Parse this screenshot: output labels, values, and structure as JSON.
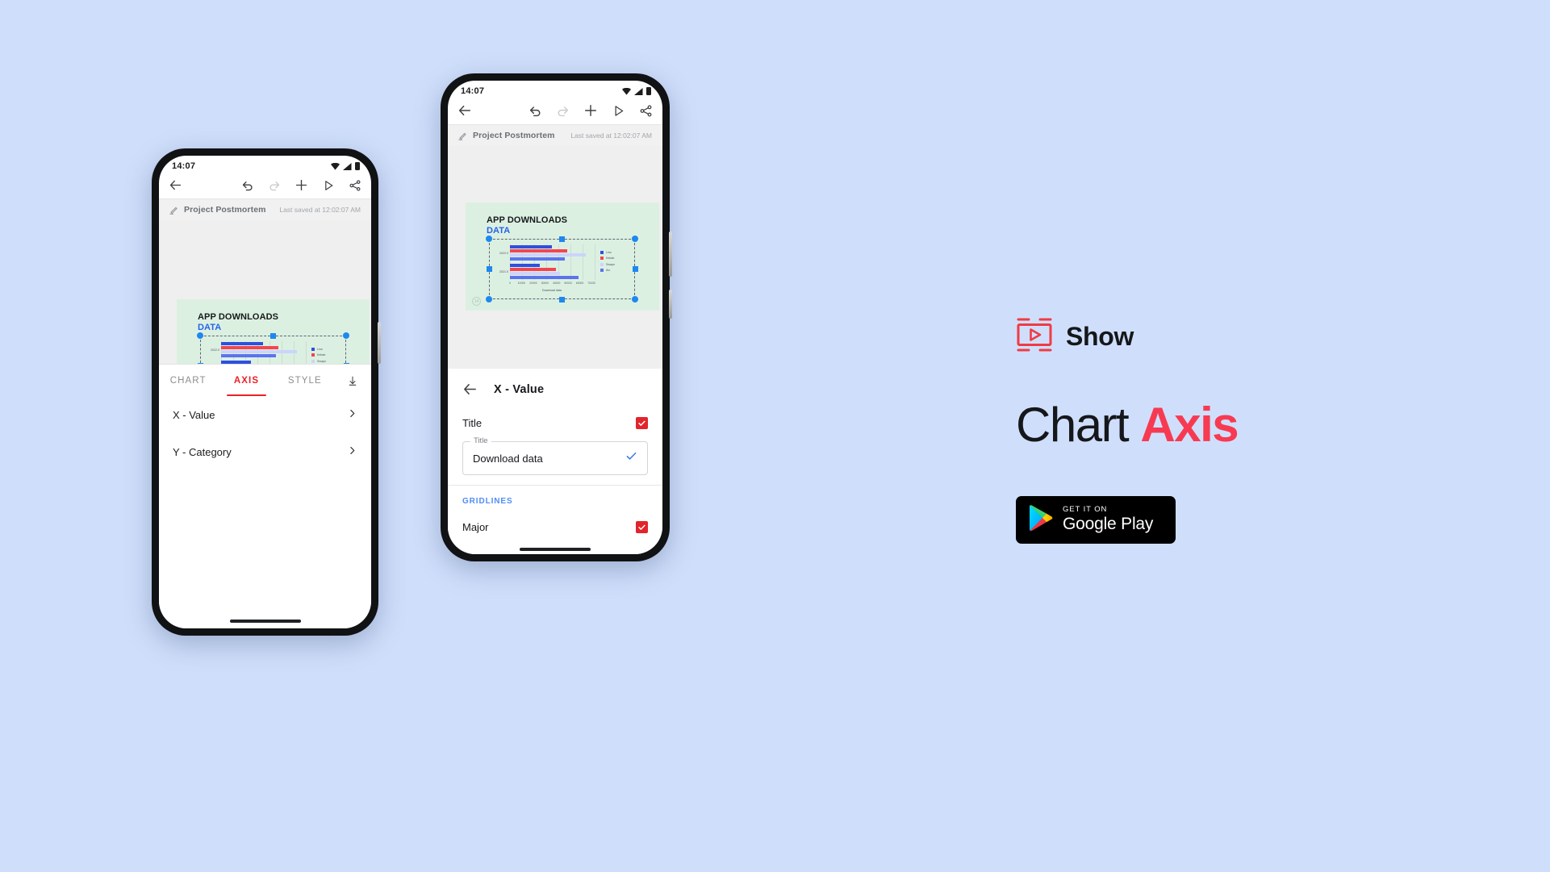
{
  "background_color": "#cfdffb",
  "accent_red": "#ea2027",
  "accent_blue": "#2563eb",
  "phone_editor": {
    "status": {
      "time": "14:07",
      "icons": [
        "wifi-icon",
        "signal-icon",
        "battery-icon"
      ]
    },
    "toolbar": {
      "back": "back-arrow-icon",
      "undo": "undo-icon",
      "redo": "redo-icon",
      "add": "plus-icon",
      "present": "play-icon",
      "share": "share-icon"
    },
    "document": {
      "icon": "edit-pencil-icon",
      "title": "Project Postmortem",
      "saved_status": "Last saved at 12:02:07 AM"
    },
    "tabs": [
      {
        "label": "CHART",
        "active": false
      },
      {
        "label": "AXIS",
        "active": true
      },
      {
        "label": "STYLE",
        "active": false
      }
    ],
    "collapse_icon": "collapse-down-icon",
    "rows": [
      {
        "label": "X - Value",
        "chevron": "chevron-right-icon"
      },
      {
        "label": "Y - Category",
        "chevron": "chevron-right-icon"
      }
    ]
  },
  "phone_detail": {
    "status": {
      "time": "14:07",
      "icons": [
        "wifi-icon",
        "signal-icon",
        "battery-icon"
      ]
    },
    "toolbar": {
      "back": "back-arrow-icon",
      "undo": "undo-icon",
      "redo": "redo-icon",
      "add": "plus-icon",
      "present": "play-icon",
      "share": "share-icon"
    },
    "document": {
      "icon": "edit-pencil-icon",
      "title": "Project Postmortem",
      "saved_status": "Last saved at 12:02:07 AM"
    },
    "sheet": {
      "back": "back-arrow-icon",
      "title": "X - Value",
      "title_row_label": "Title",
      "title_row_checked": true,
      "text_field": {
        "floating_label": "Title",
        "value": "Download data",
        "confirm_icon": "check-icon"
      },
      "section_label": "GRIDLINES",
      "gridline_rows": [
        {
          "label": "Major",
          "checked": true
        }
      ]
    }
  },
  "slide": {
    "heading_line1": "APP DOWNLOADS",
    "heading_line2": "DATA",
    "page_number": "14"
  },
  "chart_data": {
    "type": "bar",
    "orientation": "horizontal",
    "title": "APP DOWNLOADS DATA",
    "xlabel": "Download data",
    "ylabel": "",
    "categories": [
      "2021.0",
      "2022.0"
    ],
    "series": [
      {
        "name": "Lino",
        "color": "#2f4fe0",
        "values": [
          24500,
          34600
        ]
      },
      {
        "name": "Kebab",
        "color": "#f4454f",
        "values": [
          38000,
          47500
        ]
      },
      {
        "name": "Swapn",
        "color": "#ccd4fb",
        "values": [
          41500,
          62500
        ]
      },
      {
        "name": "Alo",
        "color": "#5c73ee",
        "values": [
          56800,
          45000
        ]
      }
    ],
    "xlim": [
      0,
      70000
    ],
    "xticks": [
      0,
      10000,
      20000,
      30000,
      40000,
      50000,
      60000,
      70000
    ],
    "xtick_labels": [
      "0",
      "10000",
      "20000",
      "30000",
      "40000",
      "50000",
      "60000",
      "70000"
    ],
    "grid": true,
    "legend_position": "right"
  },
  "branding": {
    "logo_icon": "show-app-icon",
    "app_name": "Show",
    "headline_plain": "Chart ",
    "headline_accent": "Axis",
    "store_badge": {
      "icon": "google-play-icon",
      "small_text": "GET IT ON",
      "big_text": "Google Play"
    }
  }
}
